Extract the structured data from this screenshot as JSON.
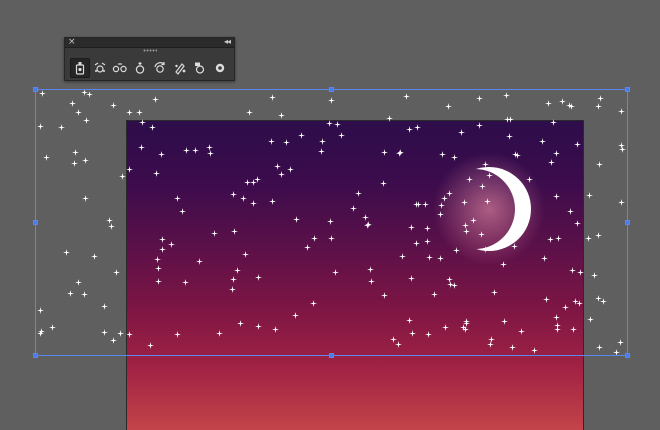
{
  "window": {
    "canvas_bg": "#5f5f5f",
    "selection_color": "#5b86ee"
  },
  "artboard": {
    "gradient_top": "#2d0d4a",
    "gradient_bottom": "#c34449"
  },
  "panel": {
    "close_glyph": "×",
    "collapse_glyph": "◂◂",
    "tools": [
      {
        "icon": "symbol-sprayer-icon",
        "active": true
      },
      {
        "icon": "symbol-shifter-icon",
        "active": false
      },
      {
        "icon": "symbol-scruncher-icon",
        "active": false
      },
      {
        "icon": "symbol-sizer-icon",
        "active": false
      },
      {
        "icon": "symbol-spinner-icon",
        "active": false
      },
      {
        "icon": "symbol-stainer-icon",
        "active": false
      },
      {
        "icon": "symbol-screener-icon",
        "active": false
      },
      {
        "icon": "symbol-styler-icon",
        "active": false
      }
    ]
  },
  "moon": {
    "color": "#ffffff",
    "glow": "#ff9fb0"
  },
  "stars": {
    "color": "#ffffff",
    "count": 220
  }
}
